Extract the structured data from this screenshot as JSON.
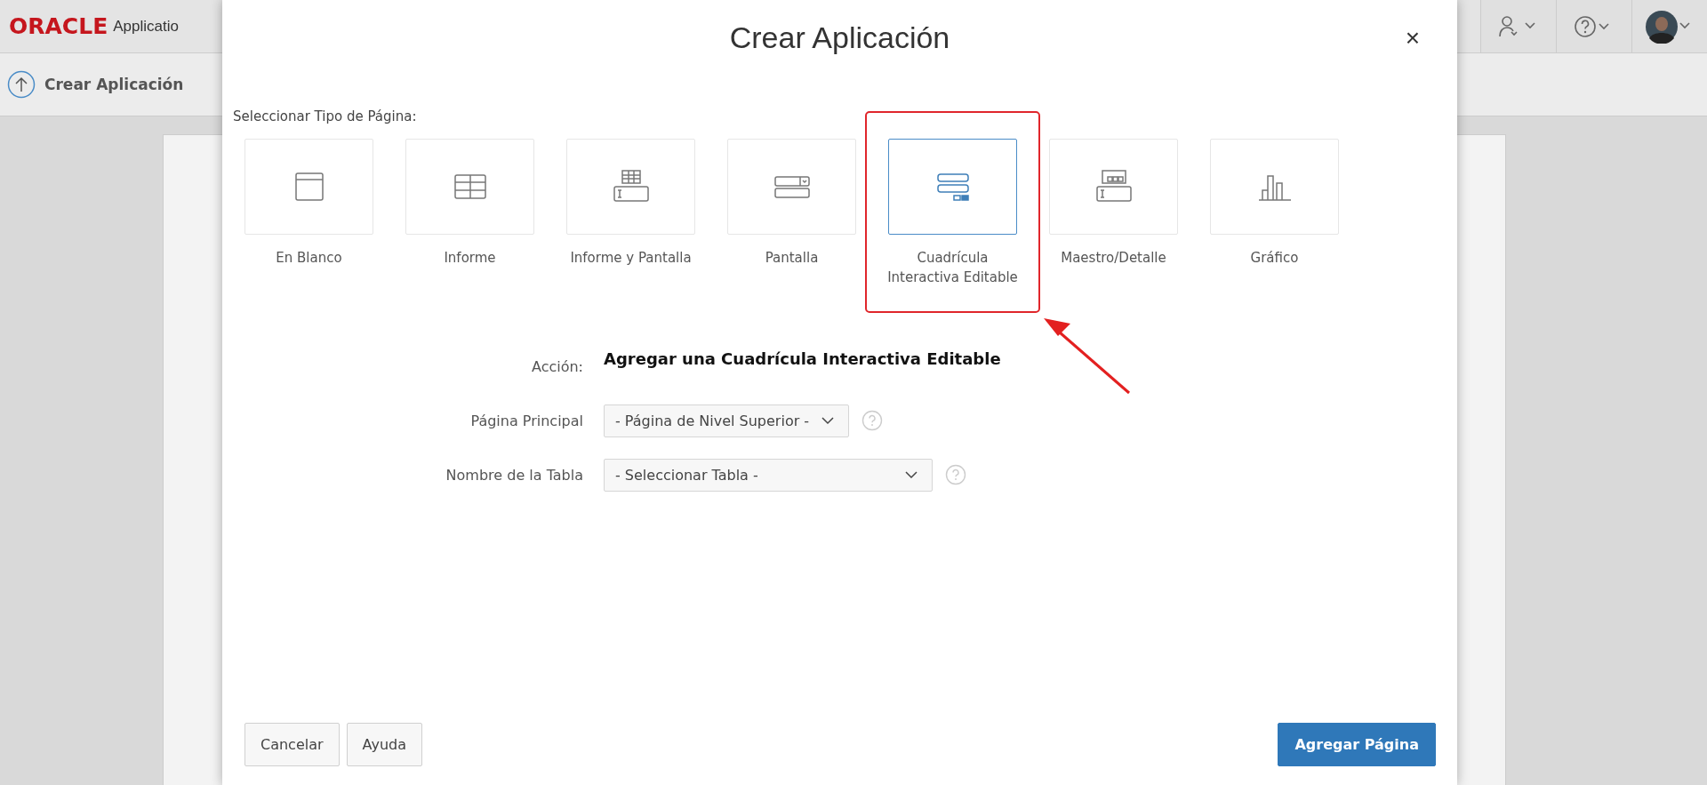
{
  "app_header": {
    "logo": "ORACLE",
    "product": "Applicatio"
  },
  "breadcrumb": {
    "title": "Crear Aplicación"
  },
  "dialog": {
    "title": "Crear Aplicación",
    "close": "×",
    "section_label": "Seleccionar Tipo de Página:",
    "page_types": [
      {
        "kind": "blank",
        "label": "En Blanco",
        "selected": false
      },
      {
        "kind": "report",
        "label": "Informe",
        "selected": false
      },
      {
        "kind": "report_form",
        "label": "Informe y Pantalla",
        "selected": false
      },
      {
        "kind": "form",
        "label": "Pantalla",
        "selected": false
      },
      {
        "kind": "grid",
        "label": "Cuadrícula Interactiva Editable",
        "selected": true
      },
      {
        "kind": "master_detail",
        "label": "Maestro/Detalle",
        "selected": false
      },
      {
        "kind": "chart",
        "label": "Gráfico",
        "selected": false
      }
    ],
    "fields": [
      {
        "kind": "text",
        "label": "Acción:",
        "value": "Agregar una Cuadrícula Interactiva Editable"
      },
      {
        "kind": "select",
        "label": "Página Principal",
        "value": "- Página de Nivel Superior -"
      },
      {
        "kind": "select",
        "label": "Nombre de la Tabla",
        "value": "- Seleccionar Tabla -"
      }
    ],
    "buttons": [
      {
        "kind": "default",
        "label": "Cancelar"
      },
      {
        "kind": "default",
        "label": "Ayuda"
      },
      {
        "kind": "primary",
        "label": "Agregar Página"
      }
    ]
  }
}
